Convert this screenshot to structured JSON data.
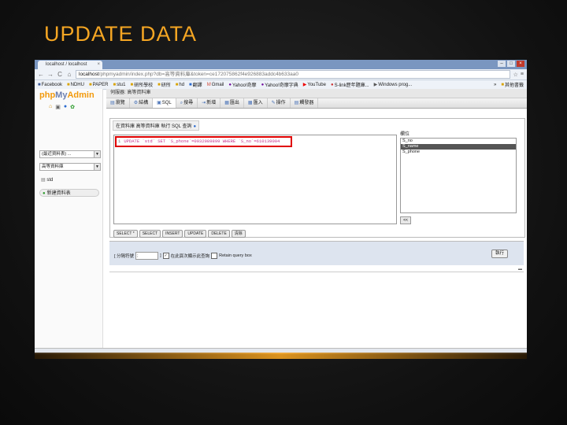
{
  "slide": {
    "title": "UPDATE DATA"
  },
  "browser": {
    "tab_title": "localhost / localhost",
    "url_host": "localhost",
    "url_path": "/phpmyadmin/index.php?db=高等資料庫&token=ce172075862f4e926883addc4b633aa0",
    "bookmarks": [
      "Facebook",
      "NDHU",
      "PAPER",
      "stu1",
      "研所學校",
      "研所",
      "hd",
      "翻譯",
      "Gmail",
      "Yahoo!奇摩",
      "Yahoo!奇摩字典",
      "YouTube",
      "S-link歷年題庫...",
      "Windows prog...",
      "其他書籤"
    ],
    "bookmarks_more": "»"
  },
  "pma": {
    "logo_php": "php",
    "logo_my": "My",
    "logo_admin": "Admin",
    "left_select1": "(最近資料表) ...",
    "left_select2": "高等資料庫",
    "left_tree_item": "std",
    "new_table_label": "新建資料表",
    "breadcrumb": "伺服器: 高等資料庫",
    "tabs": [
      "瀏覽",
      "結構",
      "SQL",
      "搜尋",
      "新增",
      "匯出",
      "匯入",
      "操作",
      "觸發器"
    ],
    "sql_box_title": "在資料庫 高等資料庫 執行 SQL 查詢",
    "sql_line_number": "1",
    "sql_query": "UPDATE `std` SET `S_phone`=0932989899 WHERE `S_no`=610139004",
    "fields_label": "欄位",
    "fields": [
      "S_no",
      "S_name",
      "S_phone"
    ],
    "selected_field": "S_name",
    "insert_button": "<<",
    "query_buttons": [
      "SELECT *",
      "SELECT",
      "INSERT",
      "UPDATE",
      "DELETE",
      "清除"
    ],
    "delimiter_label_left": "[ 分隔符號",
    "delimiter_value": ";",
    "delimiter_label_right": "]",
    "show_again_label": "在此頁次顯示此查詢",
    "retain_box_label": "Retain query box",
    "go_button": "執行"
  }
}
